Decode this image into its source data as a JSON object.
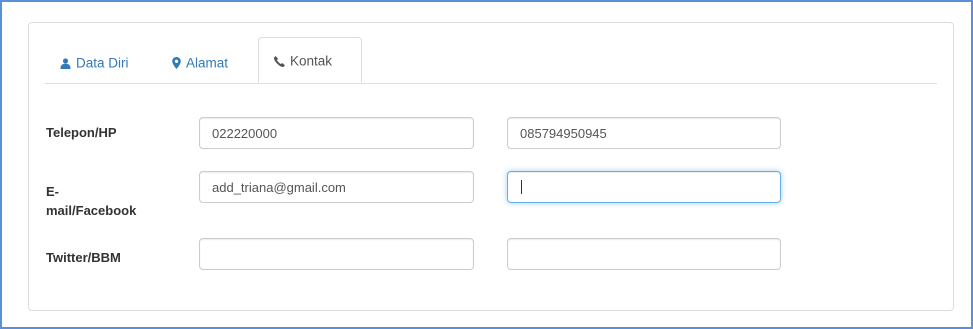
{
  "tabs": [
    {
      "label": "Data Diri",
      "icon": "user-icon",
      "active": false
    },
    {
      "label": "Alamat",
      "icon": "map-marker-icon",
      "active": false
    },
    {
      "label": "Kontak",
      "icon": "phone-icon",
      "active": true
    }
  ],
  "form": {
    "rows": [
      {
        "label": "Telepon/HP",
        "field1": "022220000",
        "field2": "085794950945"
      },
      {
        "label_line1": "E-",
        "label_line2": "mail/Facebook",
        "field1": "add_triana@gmail.com",
        "field2": ""
      },
      {
        "label": "Twitter/BBM",
        "field1": "",
        "field2": ""
      }
    ]
  },
  "colors": {
    "link": "#337ab7",
    "focus_border": "#66afe9",
    "frame_border": "#5b8fd6"
  }
}
